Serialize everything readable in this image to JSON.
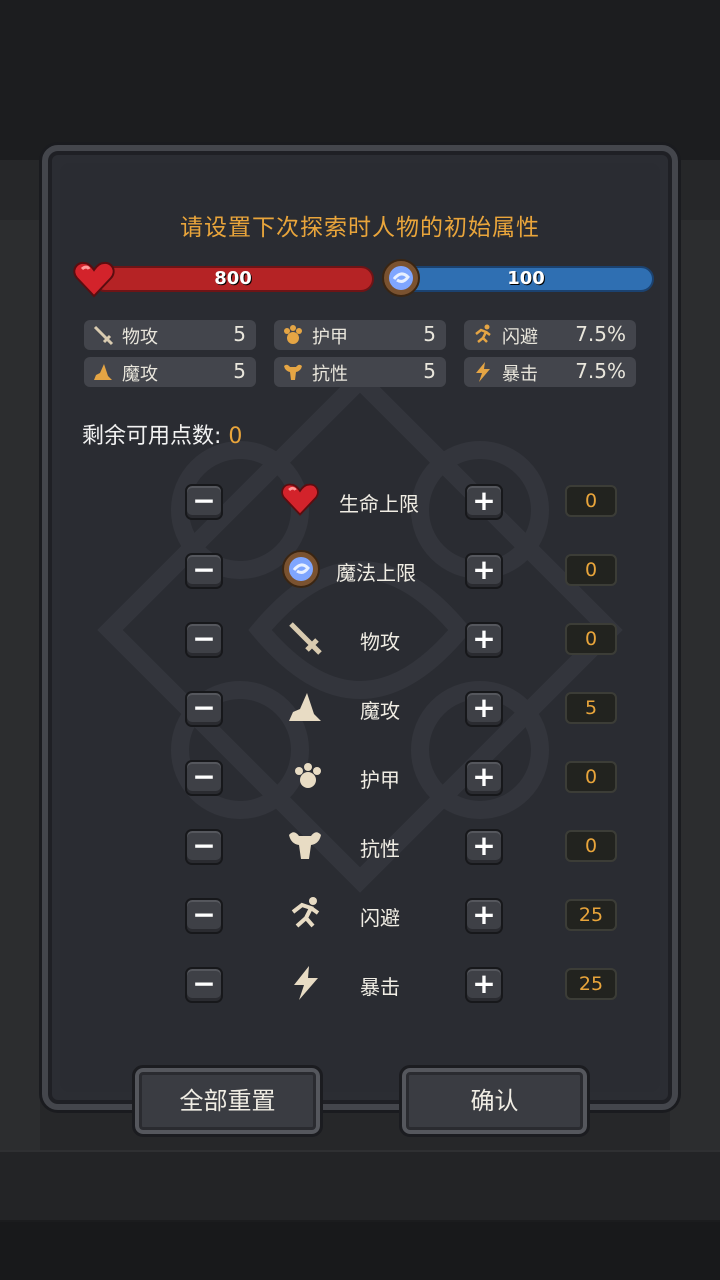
{
  "title": "请设置下次探索时人物的初始属性",
  "hp_value": "800",
  "mp_value": "100",
  "colors": {
    "accent": "#e9a53b",
    "hp": "#b52325",
    "mp": "#2f6fb2"
  },
  "stats": [
    {
      "label": "物攻",
      "value": "5",
      "icon": "sword-icon"
    },
    {
      "label": "护甲",
      "value": "5",
      "icon": "paw-armor-icon"
    },
    {
      "label": "闪避",
      "value": "7.5%",
      "icon": "running-man-icon"
    },
    {
      "label": "魔攻",
      "value": "5",
      "icon": "wizard-hat-icon"
    },
    {
      "label": "抗性",
      "value": "5",
      "icon": "muscle-icon"
    },
    {
      "label": "暴击",
      "value": "7.5%",
      "icon": "lightning-icon"
    }
  ],
  "remaining_label": "剩余可用点数:",
  "remaining_value": "0",
  "minus_glyph": "−",
  "plus_glyph": "+",
  "allocations": [
    {
      "label": "生命上限",
      "value": "0",
      "icon": "heart-icon"
    },
    {
      "label": "魔法上限",
      "value": "0",
      "icon": "mana-orb-icon"
    },
    {
      "label": "物攻",
      "value": "0",
      "icon": "sword-icon"
    },
    {
      "label": "魔攻",
      "value": "5",
      "icon": "wizard-hat-icon"
    },
    {
      "label": "护甲",
      "value": "0",
      "icon": "paw-armor-icon"
    },
    {
      "label": "抗性",
      "value": "0",
      "icon": "muscle-icon"
    },
    {
      "label": "闪避",
      "value": "25",
      "icon": "running-man-icon"
    },
    {
      "label": "暴击",
      "value": "25",
      "icon": "lightning-icon"
    }
  ],
  "reset_label": "全部重置",
  "confirm_label": "确认"
}
